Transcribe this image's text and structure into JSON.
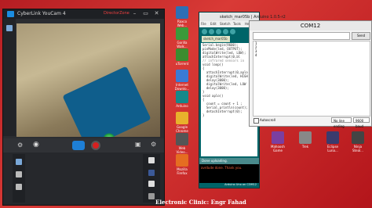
{
  "youcam": {
    "title": "CyberLink YouCam 4",
    "brand_link": "DirectorZone"
  },
  "ide": {
    "title": "sketch_mar05b | Arduino 1.0.5-r2",
    "menu": [
      "File",
      "Edit",
      "Sketch",
      "Tools",
      "Help"
    ],
    "tab": "sketch_mar05b",
    "code_lines": [
      "Serial.begin(9600);",
      "pinMode(led, OUTPUT);",
      "digitalWrite(led, LOW);",
      "attachInterrupt(0,bl",
      "// infrared sensors in",
      "",
      "void loop()",
      "{",
      "  attachInterrupt(0,aplo",
      "  digitalWrite(led, HIGH",
      "  delay(3000);",
      "  digitalWrite(led, LOW",
      "  delay(3000);",
      "}",
      "",
      "void aplo()",
      "{",
      "  count = count + 1 ;",
      "  Serial.println(count);",
      "  detachInterrupt(0);",
      "}"
    ],
    "status": "Done uploading.",
    "console": "avrdude done.  Thank you.",
    "footer": "Arduino Uno on COM12"
  },
  "serial": {
    "title": "COM12",
    "send_label": "Send",
    "output_lines": [
      "1",
      "2",
      "3",
      "4"
    ],
    "autoscroll_label": "Autoscroll",
    "line_ending": "No line ending",
    "baud": "9600 baud"
  },
  "desktop_icons": [
    {
      "label": "Raxco\nWeb...",
      "color": "#2d6fb5"
    },
    {
      "label": "Gorilla\nWalk...",
      "color": "#3a9a3a"
    },
    {
      "label": "uTorrent",
      "color": "#3c8c2f"
    },
    {
      "label": "Internet\nDownlo...",
      "color": "#3a7bd5"
    },
    {
      "label": "Arduino",
      "color": "#16888a"
    },
    {
      "label": "Google\nChrome",
      "color": "#e8b12c"
    },
    {
      "label": "Web\nVideo...",
      "color": "#555555"
    },
    {
      "label": "Mozilla\nFirefox",
      "color": "#e56d21"
    },
    {
      "label": "Mahoosh\nGame",
      "color": "#7b3fa0"
    },
    {
      "label": "Trek",
      "color": "#888888"
    },
    {
      "label": "Eclipse\nLuna...",
      "color": "#3b3b6d"
    },
    {
      "label": "Ninja\nSteal...",
      "color": "#444444"
    }
  ],
  "caption": "Electronic Clinic:  Engr Fahad"
}
